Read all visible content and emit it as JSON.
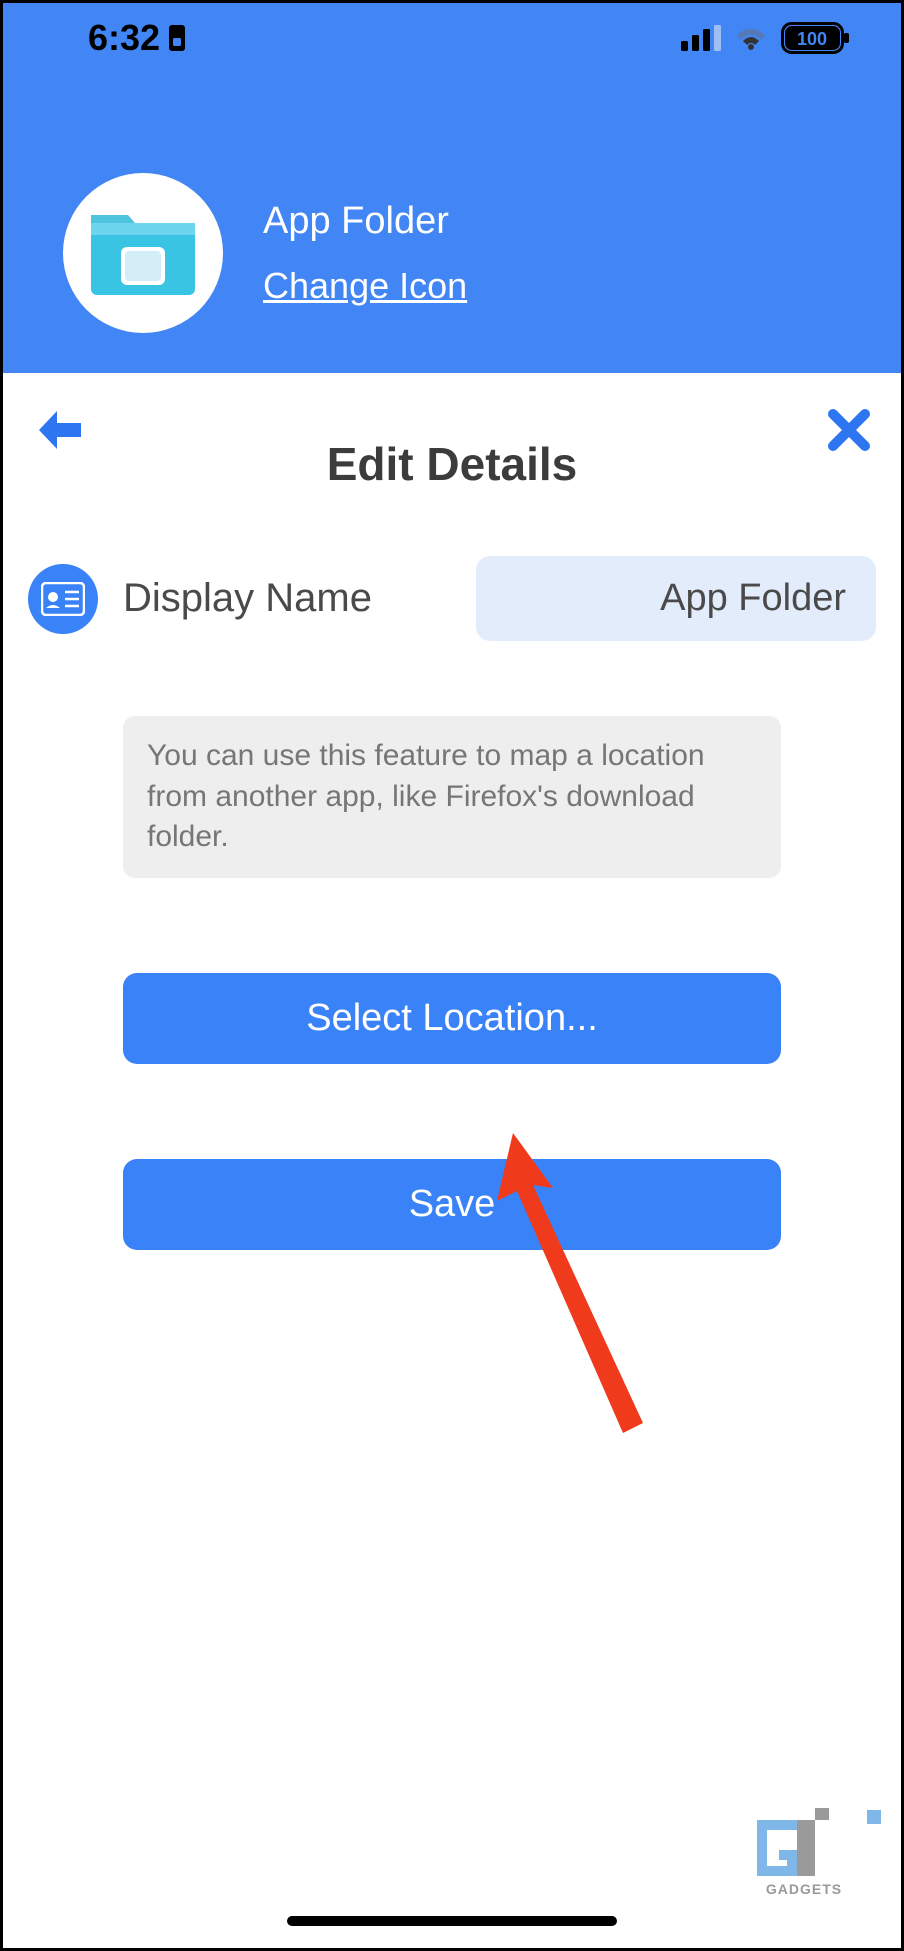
{
  "status": {
    "time": "6:32",
    "battery": "100"
  },
  "header": {
    "title": "App Folder",
    "change_icon_label": "Change Icon"
  },
  "page": {
    "title": "Edit Details"
  },
  "form": {
    "display_name_label": "Display Name",
    "display_name_value": "App Folder",
    "info_text": "You can use this feature to map a location from another app, like Firefox's download folder."
  },
  "buttons": {
    "select_location": "Select Location...",
    "save": "Save"
  },
  "watermark": {
    "text": "GADGETS"
  }
}
